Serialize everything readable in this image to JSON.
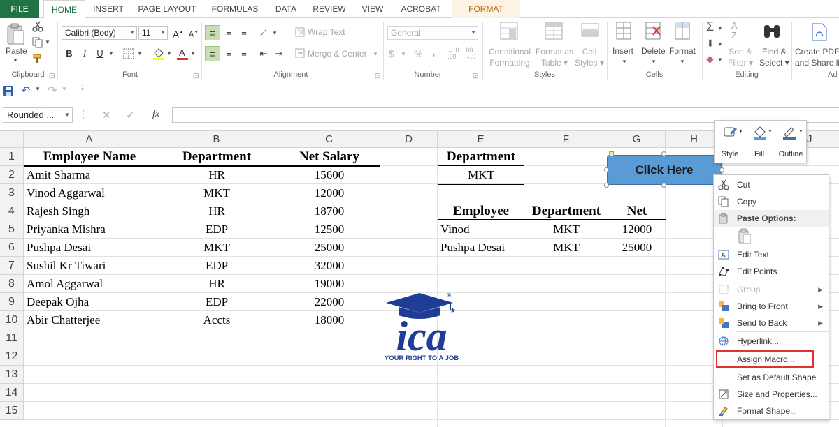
{
  "ribbon_tabs": [
    "FILE",
    "HOME",
    "INSERT",
    "PAGE LAYOUT",
    "FORMULAS",
    "DATA",
    "REVIEW",
    "VIEW",
    "ACROBAT",
    "FORMAT"
  ],
  "ribbon": {
    "paste": "Paste",
    "font_name": "Calibri (Body)",
    "font_size": "11",
    "bold": "B",
    "italic": "I",
    "underline": "U",
    "wrap_text": "Wrap Text",
    "merge_center": "Merge & Center",
    "number_format": "General",
    "percent": "%",
    "comma": ",",
    "conditional_formatting": [
      "Conditional",
      "Formatting"
    ],
    "format_as_table": [
      "Format as",
      "Table"
    ],
    "cell_styles": [
      "Cell",
      "Styles"
    ],
    "insert": "Insert",
    "delete": "Delete",
    "format": "Format",
    "sort_filter": [
      "Sort &",
      "Filter"
    ],
    "find_select": [
      "Find &",
      "Select"
    ],
    "create_pdf": [
      "Create PDF",
      "and Share lin"
    ],
    "groups": {
      "clipboard": "Clipboard",
      "font": "Font",
      "alignment": "Alignment",
      "number": "Number",
      "styles": "Styles",
      "cells": "Cells",
      "editing": "Editing",
      "adobe": "Ad"
    }
  },
  "name_box": "Rounded ...",
  "fx": "fx",
  "columns": [
    "A",
    "B",
    "C",
    "D",
    "E",
    "F",
    "G",
    "H",
    "J"
  ],
  "rows": [
    "1",
    "2",
    "3",
    "4",
    "5",
    "6",
    "7",
    "8",
    "9",
    "10",
    "11",
    "12",
    "13",
    "14",
    "15"
  ],
  "main_table": {
    "headers": [
      "Employee Name",
      "Department",
      "Net Salary"
    ],
    "rows": [
      [
        "Amit Sharma",
        "HR",
        "15600"
      ],
      [
        "Vinod Aggarwal",
        "MKT",
        "12000"
      ],
      [
        "Rajesh Singh",
        "HR",
        "18700"
      ],
      [
        "Priyanka Mishra",
        "EDP",
        "12500"
      ],
      [
        "Pushpa Desai",
        "MKT",
        "25000"
      ],
      [
        "Sushil Kr Tiwari",
        "EDP",
        "32000"
      ],
      [
        "Amol Aggarwal",
        "HR",
        "19000"
      ],
      [
        "Deepak Ojha",
        "EDP",
        "22000"
      ],
      [
        "Abir Chatterjee",
        "Accts",
        "18000"
      ]
    ]
  },
  "criteria": {
    "header": "Department",
    "value": "MKT"
  },
  "result_table": {
    "headers": [
      "Employee",
      "Department",
      "Net"
    ],
    "rows": [
      [
        "Vinod",
        "MKT",
        "12000"
      ],
      [
        "Pushpa Desai",
        "MKT",
        "25000"
      ]
    ]
  },
  "shape_text": "Click Here",
  "mini_toolbar": [
    "Style",
    "Fill",
    "Outline"
  ],
  "context_menu": {
    "cut": "Cut",
    "copy": "Copy",
    "paste_options": "Paste Options:",
    "edit_text": "Edit Text",
    "edit_points": "Edit Points",
    "group": "Group",
    "bring_to_front": "Bring to Front",
    "send_to_back": "Send to Back",
    "hyperlink": "Hyperlink...",
    "assign_macro": "Assign Macro...",
    "set_default": "Set as Default Shape",
    "size_properties": "Size and Properties...",
    "format_shape": "Format Shape..."
  },
  "logo": {
    "text": "ica",
    "tagline": "YOUR RIGHT TO A JOB",
    "registered": "®"
  },
  "colors": {
    "excel_green": "#217346",
    "shape_fill": "#5b9bd5",
    "highlight_red": "#e03030",
    "logo_blue": "#1f3c96"
  }
}
